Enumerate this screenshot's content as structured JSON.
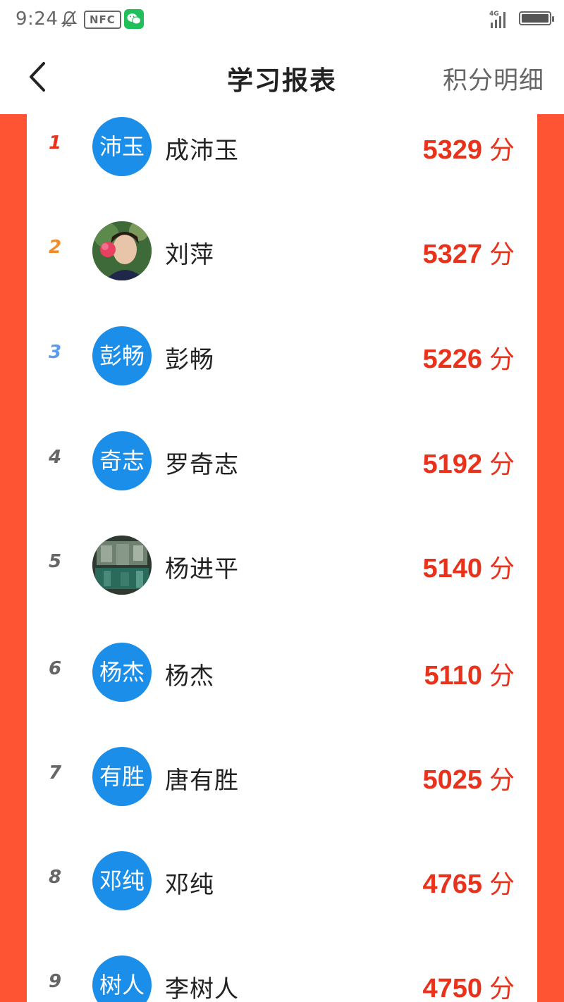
{
  "status": {
    "time": "9:24",
    "nfc": "NFC",
    "network": "4G"
  },
  "header": {
    "title": "学习报表",
    "detail_link": "积分明细"
  },
  "colors": {
    "accent": "#ff5434",
    "score": "#e8321c",
    "avatar_bg": "#1a8ee8",
    "rank1": "#e8321c",
    "rank2": "#f08c2a",
    "rank3": "#5b9cf0",
    "rank_other": "#666666"
  },
  "ranking": [
    {
      "rank": "1",
      "avatar_text": "沛玉",
      "name": "成沛玉",
      "score": "5329",
      "unit": "分"
    },
    {
      "rank": "2",
      "avatar_text": "",
      "avatar_icon": "user-photo-icon",
      "name": "刘萍",
      "score": "5327",
      "unit": "分"
    },
    {
      "rank": "3",
      "avatar_text": "彭畅",
      "name": "彭畅",
      "score": "5226",
      "unit": "分"
    },
    {
      "rank": "4",
      "avatar_text": "奇志",
      "name": "罗奇志",
      "score": "5192",
      "unit": "分"
    },
    {
      "rank": "5",
      "avatar_text": "",
      "avatar_icon": "user-photo-icon",
      "name": "杨进平",
      "score": "5140",
      "unit": "分"
    },
    {
      "rank": "6",
      "avatar_text": "杨杰",
      "name": "杨杰",
      "score": "5110",
      "unit": "分"
    },
    {
      "rank": "7",
      "avatar_text": "有胜",
      "name": "唐有胜",
      "score": "5025",
      "unit": "分"
    },
    {
      "rank": "8",
      "avatar_text": "邓纯",
      "name": "邓纯",
      "score": "4765",
      "unit": "分"
    },
    {
      "rank": "9",
      "avatar_text": "树人",
      "name": "李树人",
      "score": "4750",
      "unit": "分"
    }
  ]
}
